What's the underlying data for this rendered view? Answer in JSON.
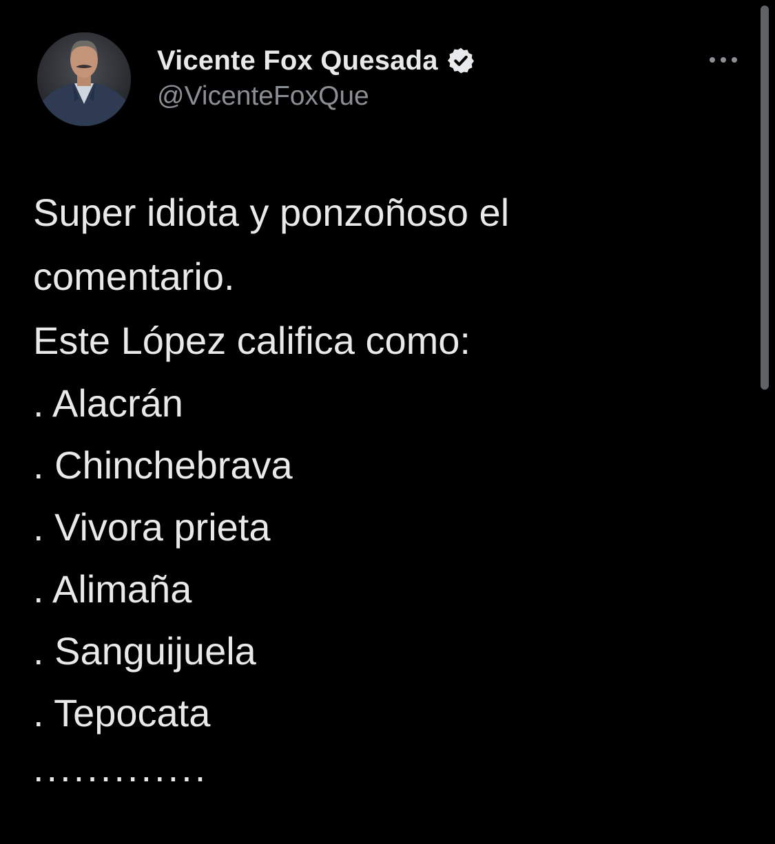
{
  "tweet": {
    "author": {
      "display_name": "Vicente Fox Quesada",
      "handle": "@VicenteFoxQue",
      "verified": true,
      "avatar_icon": "profile-photo"
    },
    "menu_icon": "more-horizontal-icon",
    "text_lines": [
      "Super idiota y ponzoñoso el",
      "comentario.",
      "Este López califica como:",
      ". Alacrán",
      ". Chinchebrava",
      ". Vivora prieta",
      ". Alimaña",
      ". Sanguijuela",
      ". Tepocata",
      "............."
    ]
  },
  "colors": {
    "background": "#000000",
    "text_primary": "#e7e9ea",
    "text_secondary": "#8b8f94",
    "scrollbar": "#606366"
  }
}
